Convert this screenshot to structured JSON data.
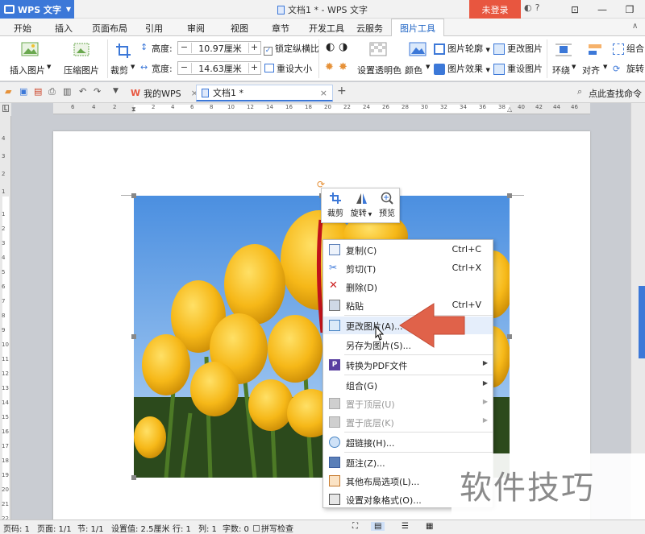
{
  "app": {
    "name": "WPS 文字",
    "doc_title": "文档1 * - WPS 文字",
    "login_label": "未登录"
  },
  "menu_tabs": [
    "开始",
    "插入",
    "页面布局",
    "引用",
    "审阅",
    "视图",
    "章节",
    "开发工具",
    "云服务",
    "图片工具"
  ],
  "active_tab": "图片工具",
  "ribbon": {
    "insert_picture": "插入图片",
    "compress_picture": "压缩图片",
    "crop": "裁剪",
    "height_label": "高度:",
    "height_value": "10.97厘米",
    "width_label": "宽度:",
    "width_value": "14.63厘米",
    "lock_ratio": "锁定纵横比",
    "reset_size": "重设大小",
    "set_transparent": "设置透明色",
    "color": "颜色",
    "picture_outline": "图片轮廓",
    "picture_effect": "图片效果",
    "change_picture": "更改图片",
    "reset_picture": "重设图片",
    "wrap": "环绕",
    "align": "对齐",
    "group": "组合",
    "rotate": "旋转"
  },
  "doc_tabs": {
    "my_wps": "我的WPS",
    "doc1": "文档1 *"
  },
  "search_cmd": "点此查找命令",
  "ruler_h": [
    "6",
    "4",
    "2",
    "2",
    "4",
    "6",
    "8",
    "10",
    "12",
    "14",
    "16",
    "18",
    "20",
    "22",
    "24",
    "26",
    "28",
    "30",
    "32",
    "34",
    "36",
    "38",
    "40",
    "42",
    "44",
    "46"
  ],
  "ruler_v": [
    "4",
    "3",
    "2",
    "1",
    "1",
    "2",
    "3",
    "4",
    "5",
    "6",
    "7",
    "8",
    "9",
    "10",
    "11",
    "12",
    "13",
    "14",
    "15",
    "16",
    "17",
    "18",
    "19",
    "20",
    "21",
    "22"
  ],
  "mini_toolbar": {
    "crop": "裁剪",
    "rotate": "旋转",
    "preview": "预览"
  },
  "context_menu": [
    {
      "label": "复制(C)",
      "shortcut": "Ctrl+C",
      "icon": "copy-icon"
    },
    {
      "label": "剪切(T)",
      "shortcut": "Ctrl+X",
      "icon": "cut-icon"
    },
    {
      "label": "删除(D)",
      "shortcut": "",
      "icon": "delete-icon"
    },
    {
      "label": "粘贴",
      "shortcut": "Ctrl+V",
      "icon": "paste-icon"
    },
    {
      "label": "更改图片(A)...",
      "shortcut": "",
      "icon": "change-picture-icon"
    },
    {
      "label": "另存为图片(S)...",
      "shortcut": "",
      "icon": ""
    },
    {
      "label": "转换为PDF文件",
      "shortcut": "",
      "icon": "pdf-icon"
    },
    {
      "label": "组合(G)",
      "shortcut": "",
      "icon": ""
    },
    {
      "label": "置于顶层(U)",
      "shortcut": "",
      "icon": "bring-front-icon"
    },
    {
      "label": "置于底层(K)",
      "shortcut": "",
      "icon": "send-back-icon"
    },
    {
      "label": "超链接(H)...",
      "shortcut": "",
      "icon": "hyperlink-icon"
    },
    {
      "label": "题注(Z)...",
      "shortcut": "",
      "icon": "caption-icon"
    },
    {
      "label": "其他布局选项(L)...",
      "shortcut": "",
      "icon": "layout-icon"
    },
    {
      "label": "设置对象格式(O)...",
      "shortcut": "",
      "icon": "format-icon"
    }
  ],
  "status": {
    "page_no": "页码: 1",
    "page": "页面: 1/1",
    "section": "节: 1/1",
    "setting": "设置值: 2.5厘米",
    "row": "行: 1",
    "col": "列: 1",
    "words": "字数: 0",
    "spell": "拼写检查"
  },
  "watermark": "软件技巧",
  "colors": {
    "accent": "#3c78d8",
    "login": "#e8563f",
    "arrow": "#e0624a"
  }
}
